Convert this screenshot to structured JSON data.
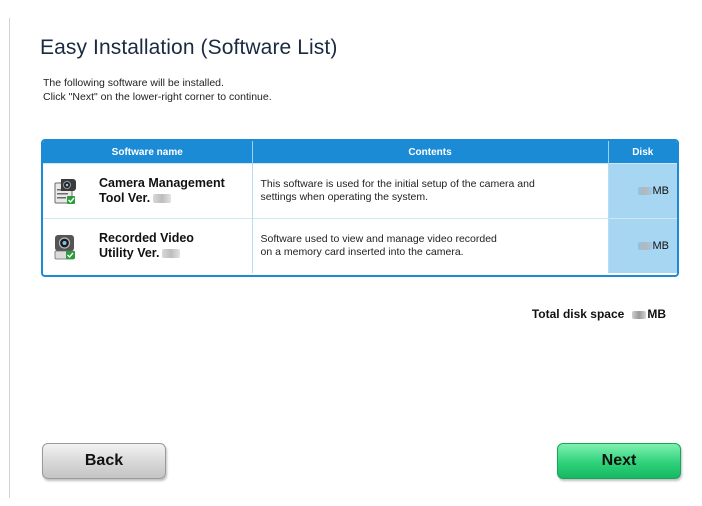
{
  "page": {
    "title": "Easy Installation (Software List)",
    "intro_line1": "The following software will be installed.",
    "intro_line2": "Click \"Next\" on the lower-right corner to continue."
  },
  "table": {
    "headers": {
      "name": "Software name",
      "contents": "Contents",
      "disk": "Disk"
    },
    "rows": [
      {
        "name_line1": "Camera Management",
        "name_line2": "Tool Ver.",
        "icon": "camera-management-icon",
        "contents_line1": "This software is used for the initial setup of the camera and",
        "contents_line2": "settings when operating the system.",
        "disk_unit": "MB"
      },
      {
        "name_line1": "Recorded Video",
        "name_line2": "Utility Ver.",
        "icon": "recorded-video-icon",
        "contents_line1": "Software used to view and manage video recorded",
        "contents_line2": "on a memory card inserted into the camera.",
        "disk_unit": "MB"
      }
    ]
  },
  "total": {
    "label": "Total disk space",
    "unit": "MB"
  },
  "buttons": {
    "back": "Back",
    "next": "Next"
  },
  "colors": {
    "accent": "#1b8bd6",
    "disk_column": "#a7d6f3",
    "next_button": "#2fd27a"
  }
}
